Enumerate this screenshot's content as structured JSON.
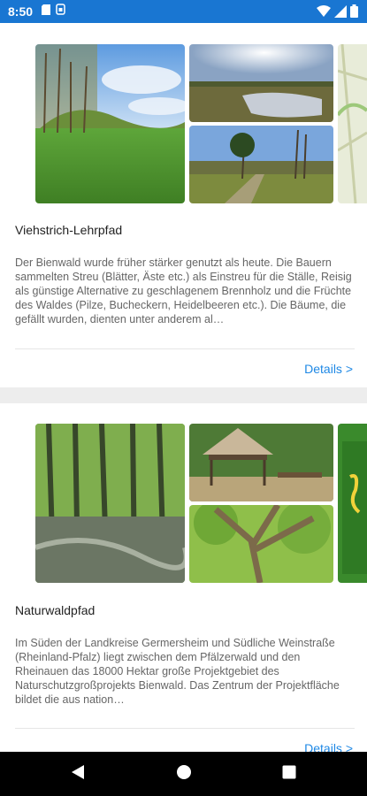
{
  "status_bar": {
    "time": "8:50",
    "left_icons": [
      "sd-card-icon",
      "sim-icon"
    ],
    "right_icons": [
      "wifi-icon",
      "signal-icon",
      "battery-icon"
    ]
  },
  "cards": [
    {
      "title": "Viehstrich-Lehrpfad",
      "description": "Der Bienwald wurde früher stärker genutzt als heute. Die Bauern sammelten Streu (Blätter, Äste etc.) als Einstreu für die Ställe, Reisig als günstige Alternative zu geschlagenem Brennholz und die Früchte des Waldes (Pilze, Bucheckern, Heidelbeeren etc.). Die Bäume, die gefällt wurden, dienten unter anderem al…",
      "details_label": "Details >"
    },
    {
      "title": "Naturwaldpfad",
      "description": "Im Süden der Landkreise Germersheim und Südliche Weinstraße (Rheinland-Pfalz) liegt zwischen dem Pfälzerwald und den Rheinauen das 18000 Hektar große Projektgebiet des Naturschutzgroßprojekts Bienwald. Das Zentrum der Projektfläche bildet die aus nation…",
      "details_label": "Details >"
    }
  ],
  "nav_bar": {
    "icons": [
      "back-icon",
      "home-icon",
      "recents-icon"
    ]
  },
  "colors": {
    "status_bar": "#1976d2",
    "link": "#1e88e5",
    "separator": "#ededed"
  }
}
